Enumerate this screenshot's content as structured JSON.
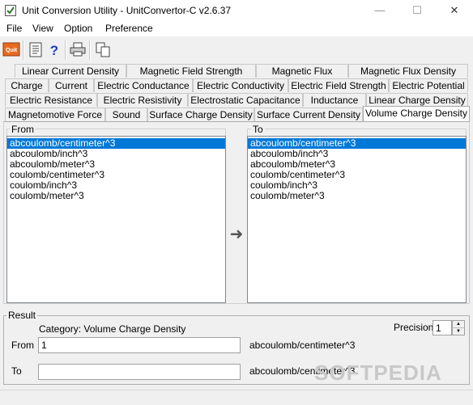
{
  "window": {
    "title": "Unit Conversion Utility - UnitConvertor-C v2.6.37",
    "minimize": "—",
    "maximize": "☐",
    "close": "✕"
  },
  "menu": [
    "File",
    "View",
    "Option",
    "Preference"
  ],
  "toolbar": {
    "icons": [
      "quit-icon",
      "notes-icon",
      "help-icon",
      "print-icon",
      "copy-icon"
    ],
    "quit_label": "Quit"
  },
  "tabs": {
    "row1": [
      "Linear Current Density",
      "Magnetic Field Strength",
      "Magnetic Flux",
      "Magnetic Flux Density"
    ],
    "row2": [
      "Charge",
      "Current",
      "Electric Conductance",
      "Electric Conductivity",
      "Electric Field Strength",
      "Electric Potential"
    ],
    "row3": [
      "Electric Resistance",
      "Electric Resistivity",
      "Electrostatic Capacitance",
      "Inductance",
      "Linear Charge Density"
    ],
    "row4": [
      "Magnetomotive Force",
      "Sound",
      "Surface Charge Density",
      "Surface Current Density",
      "Volume Charge Density"
    ],
    "active": "Volume Charge Density"
  },
  "from_panel": {
    "label": "From",
    "selected": 0,
    "items": [
      "abcoulomb/centimeter^3",
      "abcoulomb/inch^3",
      "abcoulomb/meter^3",
      "coulomb/centimeter^3",
      "coulomb/inch^3",
      "coulomb/meter^3"
    ]
  },
  "to_panel": {
    "label": "To",
    "selected": 0,
    "items": [
      "abcoulomb/centimeter^3",
      "abcoulomb/inch^3",
      "abcoulomb/meter^3",
      "coulomb/centimeter^3",
      "coulomb/inch^3",
      "coulomb/meter^3"
    ]
  },
  "convert_arrow": "➜",
  "result": {
    "label": "Result",
    "category": "Category: Volume Charge Density",
    "precision_label": "Precision",
    "precision_value": "1",
    "from_label": "From",
    "from_value": "1",
    "from_unit": "abcoulomb/centimeter^3",
    "to_label": "To",
    "to_value": "",
    "to_unit": "abcoulomb/centimeter^3"
  },
  "watermark": "SOFTPEDIA"
}
